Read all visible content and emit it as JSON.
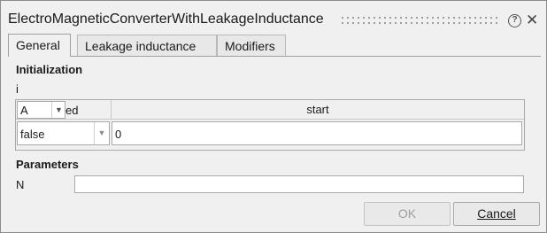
{
  "window": {
    "title": "ElectroMagneticConverterWithLeakageInductance",
    "help_glyph": "?",
    "close_glyph": "✕"
  },
  "tabs": [
    {
      "label": "General",
      "active": true
    },
    {
      "label": "Leakage inductance",
      "active": false
    },
    {
      "label": "Modifiers",
      "active": false
    }
  ],
  "initialization": {
    "title": "Initialization",
    "variable": "i",
    "unit": "A",
    "fixed_header_visible": "ed",
    "start_header": "start",
    "fixed_value": "false",
    "start_value": "0"
  },
  "parameters": {
    "title": "Parameters",
    "n_label": "N",
    "n_value": ""
  },
  "buttons": {
    "ok": "OK",
    "cancel": "Cancel"
  },
  "colors": {
    "dialog_bg": "#f0f0f0",
    "field_bg": "#ffffff",
    "border": "#a9a9a9",
    "disabled_text": "#a0a0a0"
  },
  "icons": {
    "help": "help-icon",
    "close": "close-icon",
    "dropdown": "chevron-down-icon"
  }
}
